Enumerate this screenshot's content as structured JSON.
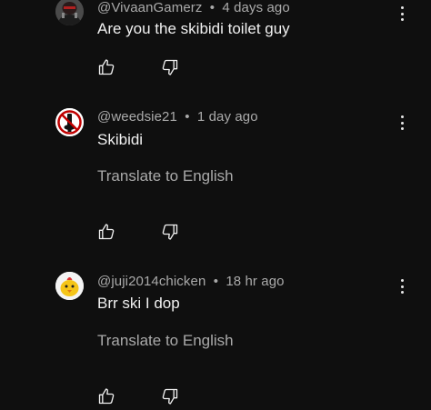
{
  "comments": [
    {
      "author": "@VivaanGamerz",
      "separator": "•",
      "time": "4 days ago",
      "text": "Are you the skibidi toilet guy",
      "translate": "",
      "avatar_icon": "dark-character-avatar"
    },
    {
      "author": "@weedsie21",
      "separator": "•",
      "time": "1 day ago",
      "text": "Skibidi",
      "translate": "Translate to English",
      "avatar_icon": "no-toilet-sign-avatar"
    },
    {
      "author": "@juji2014chicken",
      "separator": "•",
      "time": "18 hr ago",
      "text": "Brr ski I dop",
      "translate": "Translate to English",
      "avatar_icon": "yellow-chick-avatar"
    }
  ],
  "icons": {
    "like": "thumbs-up-icon",
    "dislike": "thumbs-down-icon",
    "more": "more-vert-icon"
  },
  "colors": {
    "background": "#0f0f0f",
    "primary_text": "#f1f1f1",
    "secondary_text": "#aaaaaa"
  }
}
